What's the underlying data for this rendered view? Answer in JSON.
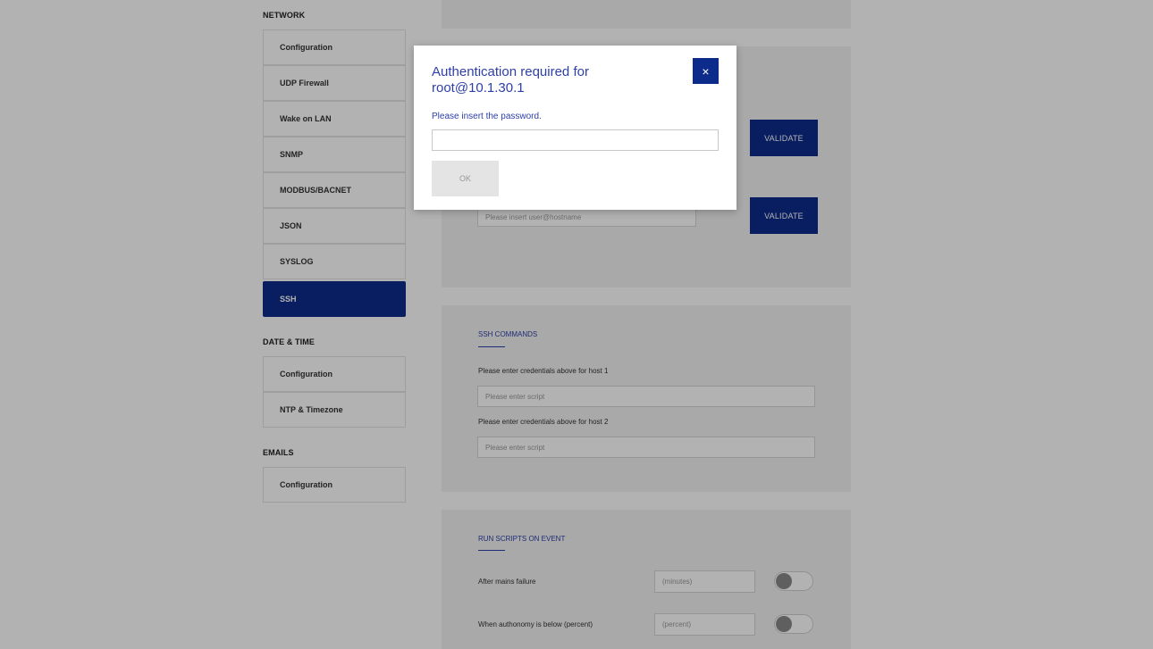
{
  "sidebar": {
    "network_title": "NETWORK",
    "network_items": [
      "Configuration",
      "UDP Firewall",
      "Wake on LAN",
      "SNMP",
      "MODBUS/BACNET",
      "JSON",
      "SYSLOG",
      "SSH"
    ],
    "datetime_title": "DATE & TIME",
    "datetime_items": [
      "Configuration",
      "NTP & Timezone"
    ],
    "emails_title": "EMAILS",
    "emails_items": [
      "Configuration"
    ]
  },
  "ssh_hosts": {
    "validate_label": "VALIDATE",
    "host2_placeholder": "Please insert user@hostname"
  },
  "ssh_commands": {
    "title": "SSH COMMANDS",
    "host1_label": "Please enter credentials above for host 1",
    "host1_placeholder": "Please enter script",
    "host2_label": "Please enter credentials above for host 2",
    "host2_placeholder": "Please enter script"
  },
  "run_scripts": {
    "title": "RUN SCRIPTS ON EVENT",
    "mains_label": "After mains failure",
    "mains_placeholder": "(minutes)",
    "autonomy_label": "When authonomy is below (percent)",
    "autonomy_placeholder": "(percent)"
  },
  "modal": {
    "title": "Authentication required for root@10.1.30.1",
    "close_glyph": "×",
    "message": "Please insert the password.",
    "ok_label": "OK"
  }
}
